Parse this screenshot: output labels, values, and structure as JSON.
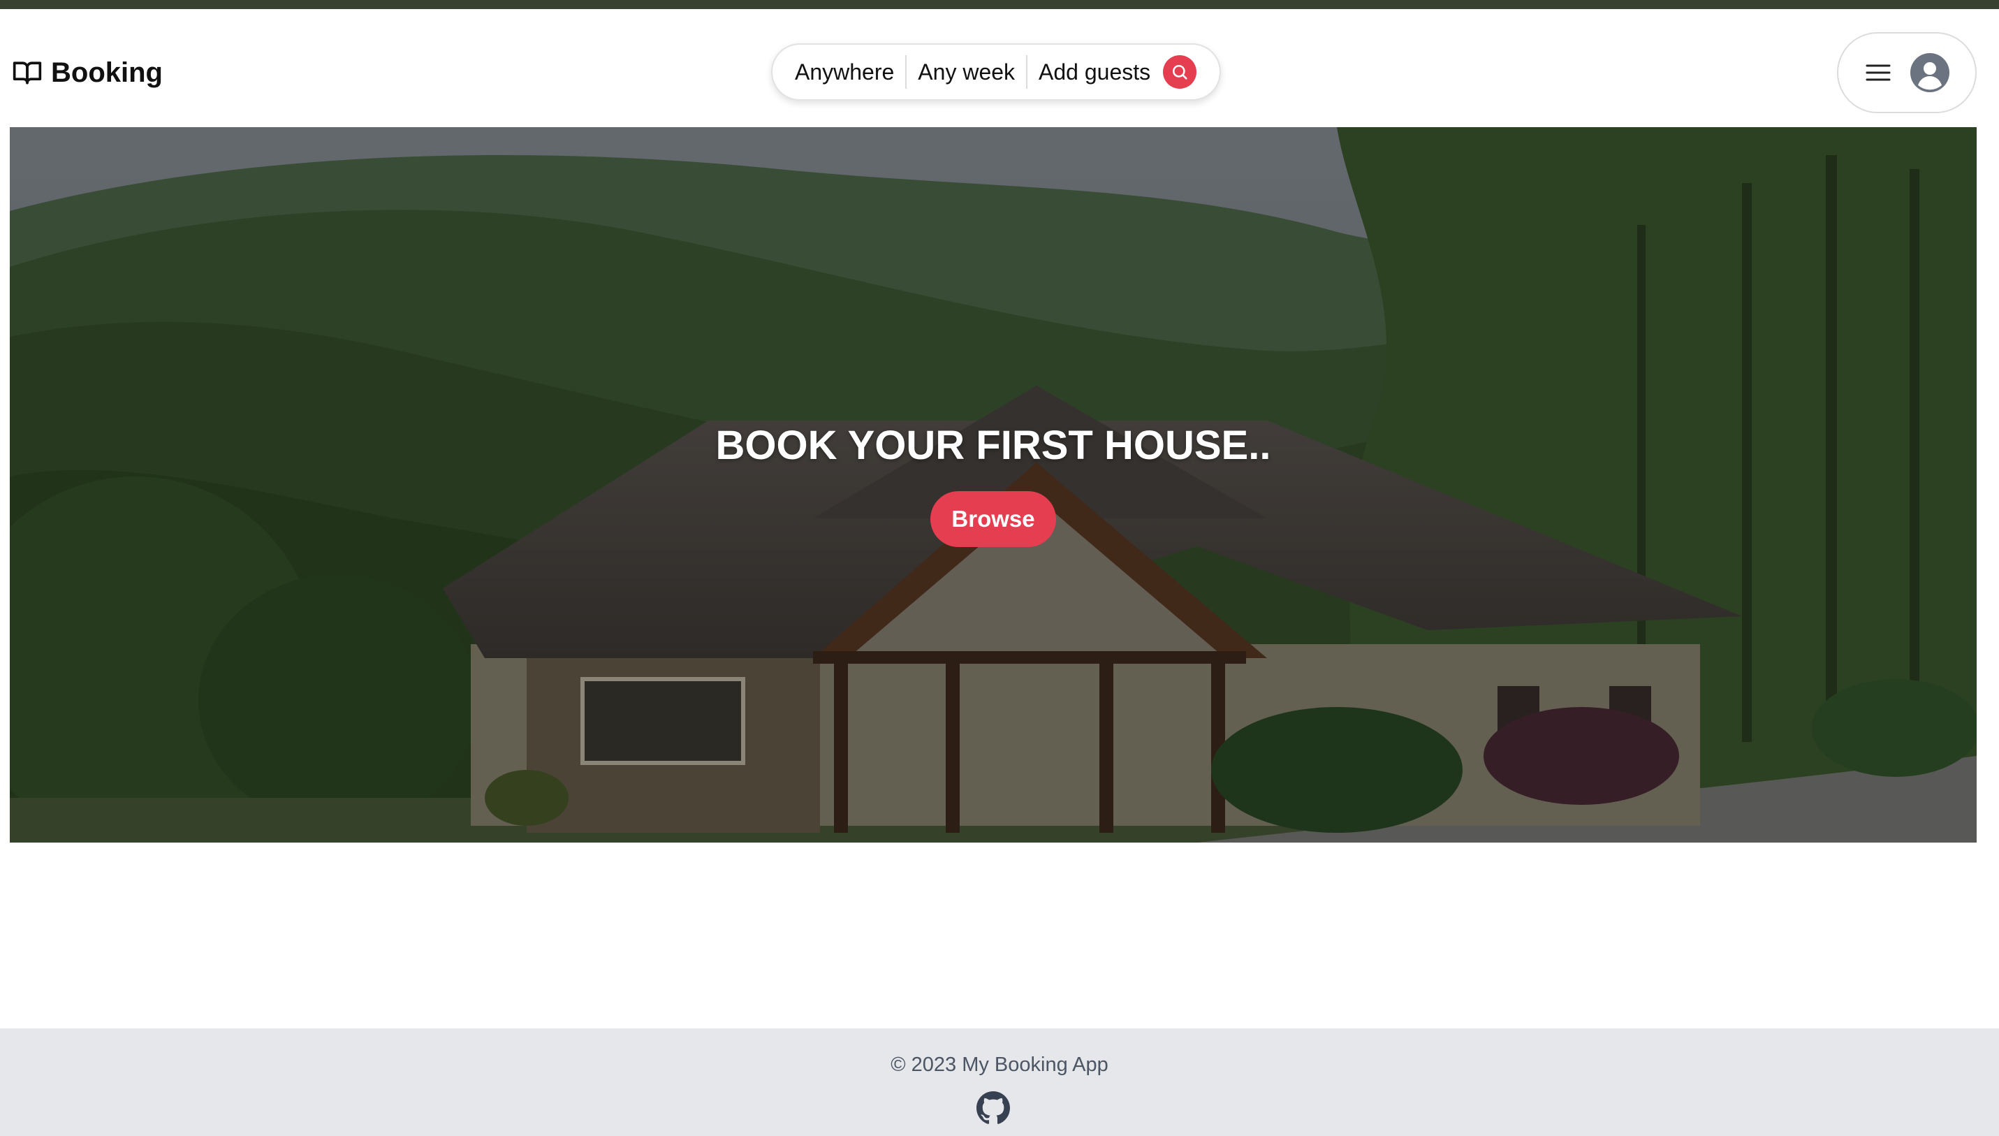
{
  "header": {
    "logo_text": "Booking",
    "search": {
      "location": "Anywhere",
      "week": "Any week",
      "guests": "Add guests"
    }
  },
  "hero": {
    "title": "BOOK YOUR FIRST HOUSE..",
    "button_label": "Browse"
  },
  "footer": {
    "copyright": "© 2023 My Booking App"
  },
  "icons": {
    "logo": "book-open-icon",
    "search": "search-icon",
    "menu": "hamburger-menu-icon",
    "avatar": "user-avatar-icon",
    "github": "github-icon"
  },
  "colors": {
    "accent": "#e53e51",
    "top_strip": "#384030",
    "footer_bg": "#e5e7eb"
  }
}
